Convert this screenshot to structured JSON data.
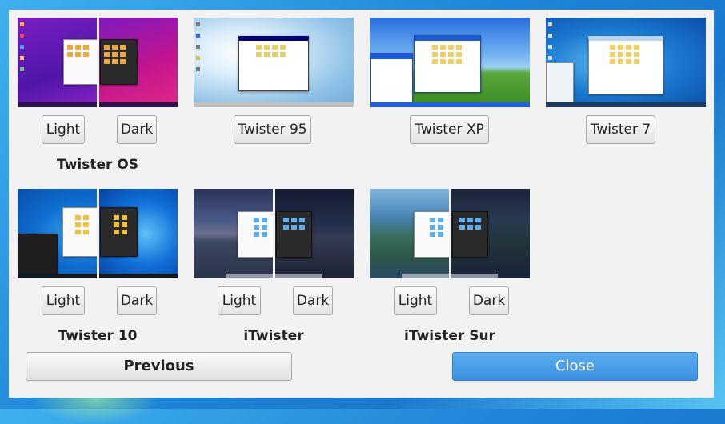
{
  "themes": [
    {
      "name": "Twister OS",
      "buttons": [
        "Light",
        "Dark"
      ]
    },
    {
      "name": "",
      "buttons": [
        "Twister 95"
      ]
    },
    {
      "name": "",
      "buttons": [
        "Twister XP"
      ]
    },
    {
      "name": "",
      "buttons": [
        "Twister 7"
      ]
    },
    {
      "name": "Twister 10",
      "buttons": [
        "Light",
        "Dark"
      ]
    },
    {
      "name": "iTwister",
      "buttons": [
        "Light",
        "Dark"
      ]
    },
    {
      "name": "iTwister Sur",
      "buttons": [
        "Light",
        "Dark"
      ]
    }
  ],
  "footer": {
    "previous_label": "Previous",
    "close_label": "Close"
  },
  "colors": {
    "accent": "#3a98e6",
    "dialog_bg": "#f2f2f2"
  }
}
